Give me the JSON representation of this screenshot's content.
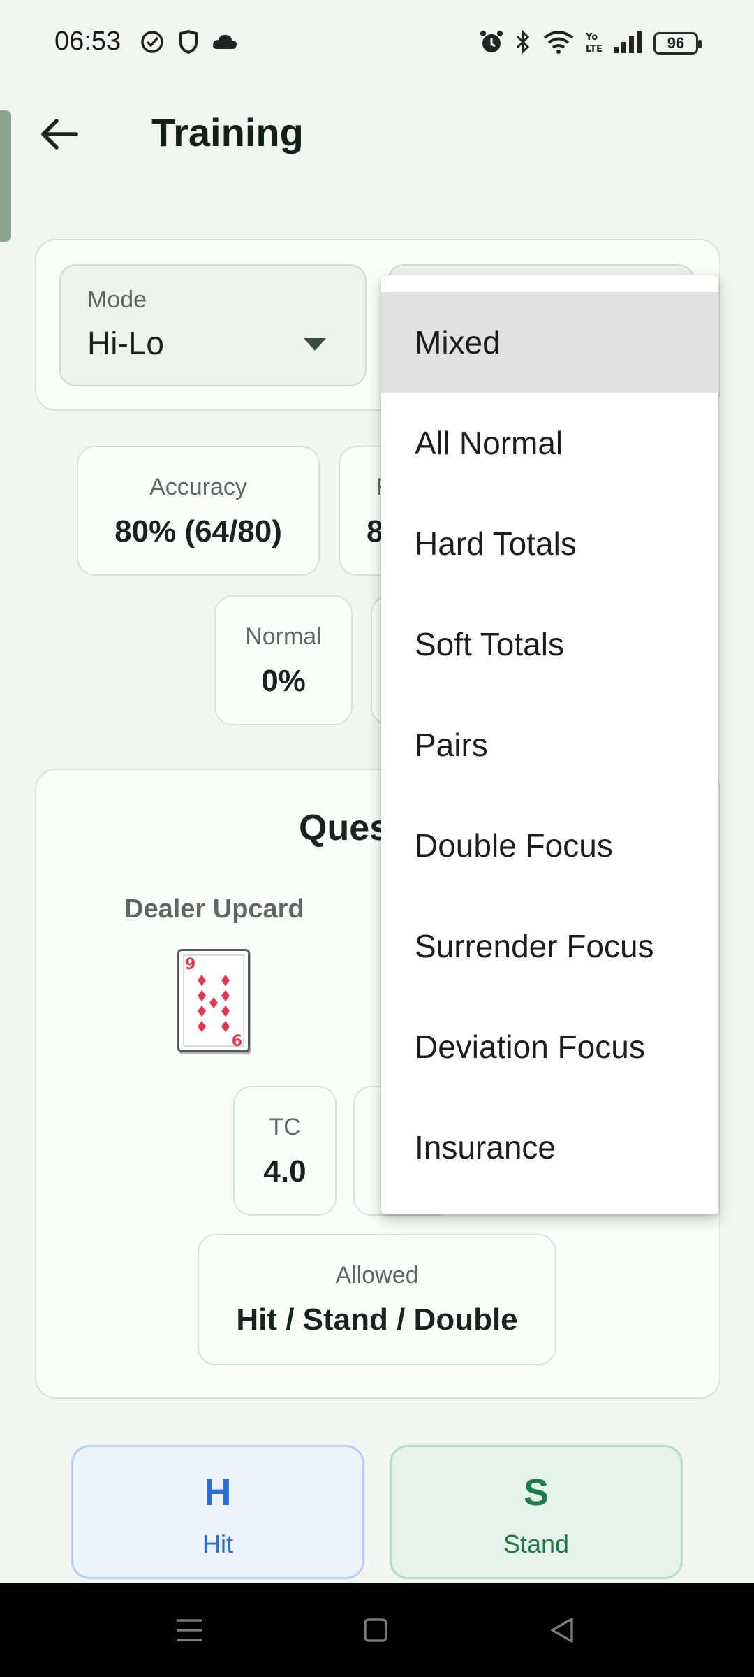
{
  "status_bar": {
    "time": "06:53",
    "battery": "96",
    "left_icons": [
      "check-circle-icon",
      "shield-icon",
      "cloud-icon"
    ],
    "right_icons": [
      "alarm-icon",
      "bluetooth-icon",
      "wifi-icon",
      "volte-icon",
      "signal-icon",
      "battery-icon"
    ]
  },
  "header": {
    "title": "Training"
  },
  "settings": {
    "mode_label": "Mode",
    "mode_value": "Hi-Lo"
  },
  "stats": {
    "accuracy_label": "Accuracy",
    "accuracy_value": "80% (64/80)",
    "second_partial_label": "F",
    "second_partial_value": "8",
    "normal_label": "Normal",
    "normal_value": "0%"
  },
  "question": {
    "title_partial": "Ques",
    "dealer_label": "Dealer Upcard",
    "dealer_card": {
      "rank_top": "9",
      "rank_bottom": "6",
      "suit": "diamonds",
      "suit_color": "#e5364b"
    },
    "tc_label": "TC",
    "tc_value": "4.0",
    "allowed_label": "Allowed",
    "allowed_value": "Hit / Stand / Double"
  },
  "actions": {
    "hit_key": "H",
    "hit_label": "Hit",
    "hit_color": "#2a6fdb",
    "stand_key": "S",
    "stand_label": "Stand",
    "stand_color": "#1f7a45"
  },
  "dropdown": {
    "selected": "Mixed",
    "items": [
      "Mixed",
      "All Normal",
      "Hard Totals",
      "Soft Totals",
      "Pairs",
      "Double Focus",
      "Surrender Focus",
      "Deviation Focus",
      "Insurance"
    ]
  }
}
